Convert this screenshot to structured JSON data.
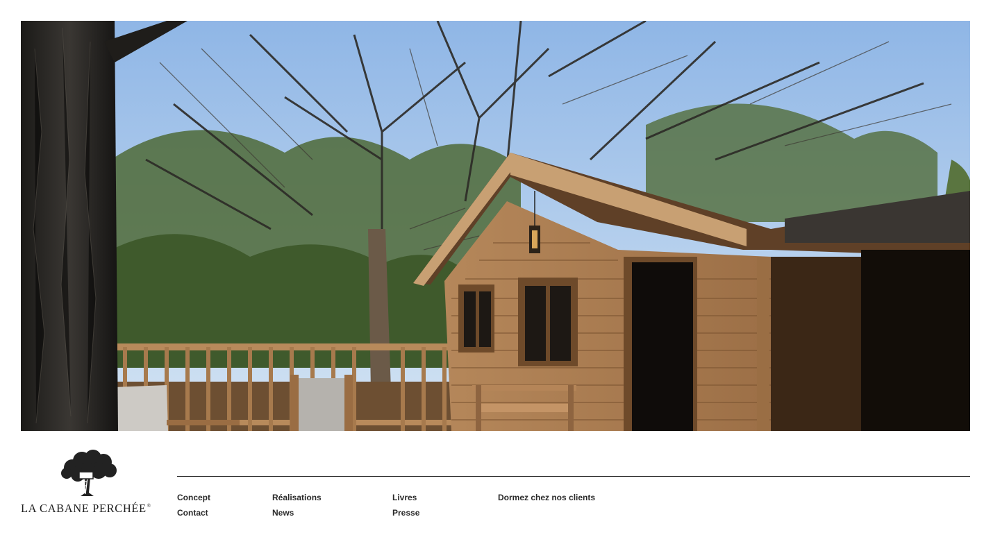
{
  "hero": {
    "image": "wooden-treehouse-cabin-under-pine-trees"
  },
  "brand": {
    "name": "LA CABANE PERCHÉE",
    "trademark": "®",
    "logo_icon": "tree-with-ladder-icon"
  },
  "footer_nav": {
    "col1": [
      "Concept",
      "Contact"
    ],
    "col2": [
      "Réalisations",
      "News"
    ],
    "col3": [
      "Livres",
      "Presse"
    ],
    "col4": [
      "Dormez chez nos clients"
    ]
  },
  "colors": {
    "text": "#222222",
    "background": "#ffffff",
    "sky": "#9cc3ec",
    "wood": "#a5764a"
  }
}
